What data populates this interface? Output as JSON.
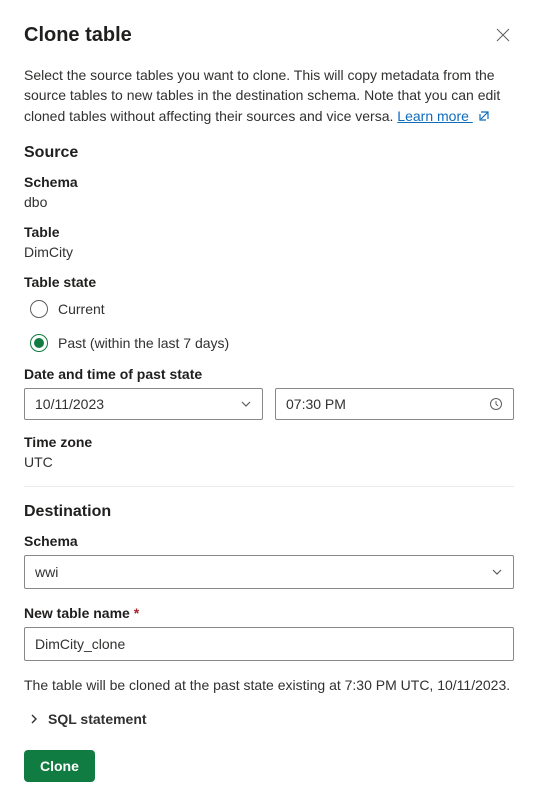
{
  "dialog": {
    "title": "Clone table",
    "description": "Select the source tables you want to clone. This will copy metadata from the source tables to new tables in the destination schema. Note that you can edit cloned tables without affecting their sources and vice versa. ",
    "learn_more": "Learn more "
  },
  "source": {
    "heading": "Source",
    "schema_label": "Schema",
    "schema_value": "dbo",
    "table_label": "Table",
    "table_value": "DimCity",
    "state_label": "Table state",
    "state_options": {
      "current": "Current",
      "past": "Past (within the last 7 days)",
      "selected": "past"
    },
    "datetime_label": "Date and time of past state",
    "date_value": "10/11/2023",
    "time_value": "07:30 PM",
    "tz_label": "Time zone",
    "tz_value": "UTC"
  },
  "destination": {
    "heading": "Destination",
    "schema_label": "Schema",
    "schema_value": "wwi",
    "name_label": "New table name",
    "name_value": "DimCity_clone"
  },
  "summary": "The table will be cloned at the past state existing at 7:30 PM UTC, 10/11/2023.",
  "expander": "SQL statement",
  "actions": {
    "clone": "Clone"
  }
}
